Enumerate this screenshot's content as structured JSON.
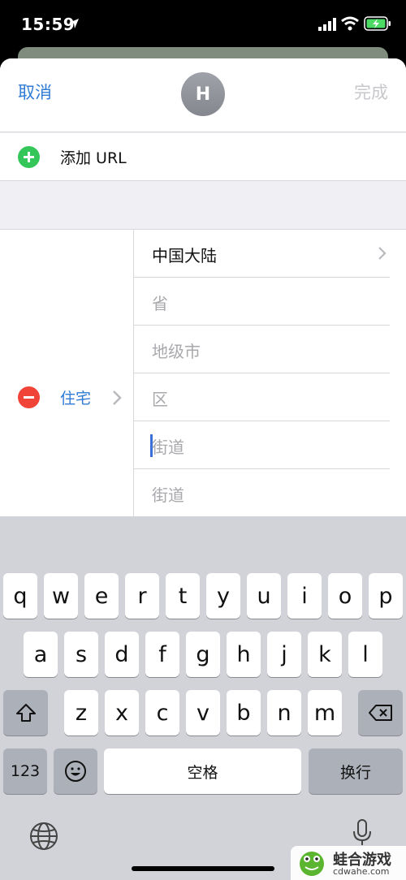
{
  "status_bar": {
    "time": "15:59"
  },
  "nav": {
    "cancel_label": "取消",
    "avatar_initial": "H",
    "done_label": "完成"
  },
  "url_row": {
    "label": "添加 URL"
  },
  "address": {
    "type_label": "住宅",
    "fields": [
      {
        "value": "中国大陆",
        "placeholder": ""
      },
      {
        "value": "",
        "placeholder": "省"
      },
      {
        "value": "",
        "placeholder": "地级市"
      },
      {
        "value": "",
        "placeholder": "区"
      },
      {
        "value": "",
        "placeholder": "街道"
      },
      {
        "value": "",
        "placeholder": "街道"
      }
    ]
  },
  "keyboard": {
    "row1": [
      "q",
      "w",
      "e",
      "r",
      "t",
      "y",
      "u",
      "i",
      "o",
      "p"
    ],
    "row2": [
      "a",
      "s",
      "d",
      "f",
      "g",
      "h",
      "j",
      "k",
      "l"
    ],
    "row3": [
      "z",
      "x",
      "c",
      "v",
      "b",
      "n",
      "m"
    ],
    "numbers_label": "123",
    "space_label": "空格",
    "return_label": "换行",
    "shift_icon": "shift-icon",
    "delete_icon": "delete-icon",
    "emoji_icon": "emoji-icon"
  },
  "watermark": {
    "title": "蛙合游戏",
    "subtitle": "cdwahe.com"
  },
  "colors": {
    "accent": "#2f7bd5",
    "add_green": "#35c659",
    "remove_red": "#f04438"
  }
}
